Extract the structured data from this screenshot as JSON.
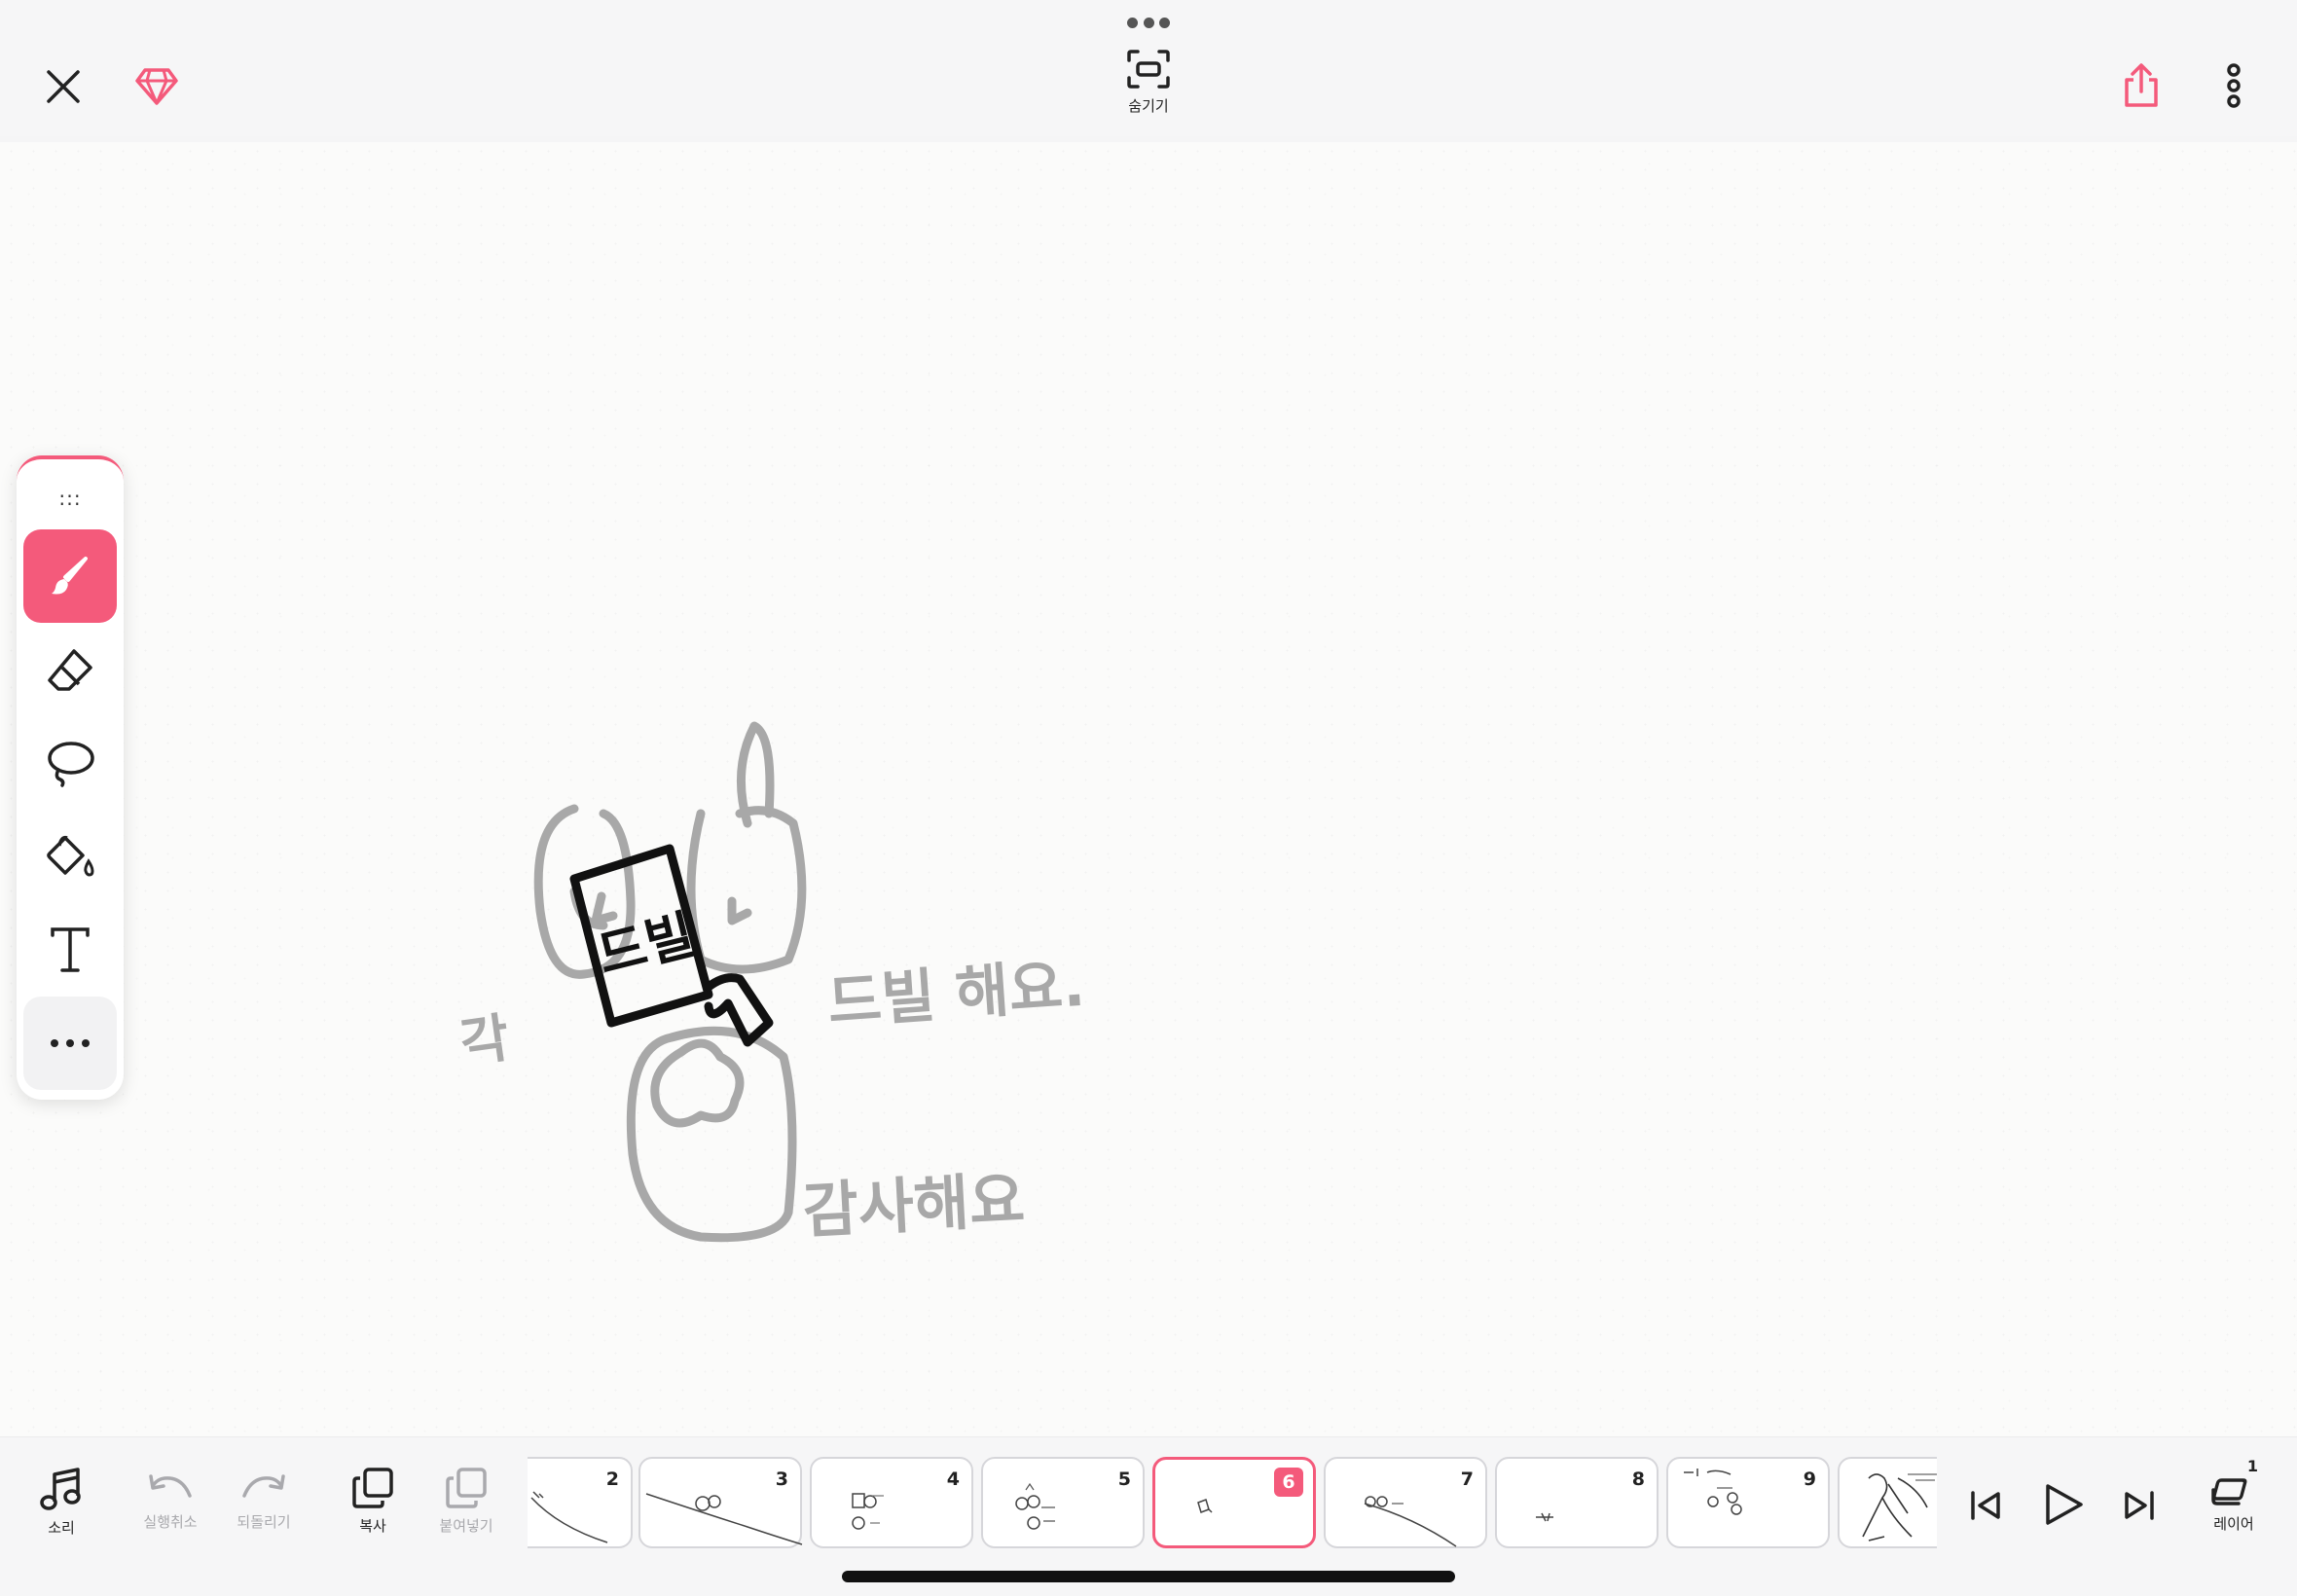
{
  "top_bar": {
    "hide_label": "숨기기"
  },
  "canvas": {
    "drawing_texts": {
      "sign": "드빌",
      "line1_left": "각",
      "line1_right": "드빌 해요.",
      "line2_right": "감사해요"
    }
  },
  "bottom_bar": {
    "sound_label": "소리",
    "undo_label": "실행취소",
    "redo_label": "되돌리기",
    "copy_label": "복사",
    "paste_label": "붙여넣기",
    "layer_label": "레이어",
    "layer_count": "1",
    "frames": [
      {
        "num": "2"
      },
      {
        "num": "3"
      },
      {
        "num": "4"
      },
      {
        "num": "5"
      },
      {
        "num": "6",
        "active": true
      },
      {
        "num": "7"
      },
      {
        "num": "8"
      },
      {
        "num": "9"
      },
      {
        "num": ""
      }
    ]
  },
  "colors": {
    "accent": "#f45a7b",
    "pencil_gray": "#a8a8a8"
  }
}
